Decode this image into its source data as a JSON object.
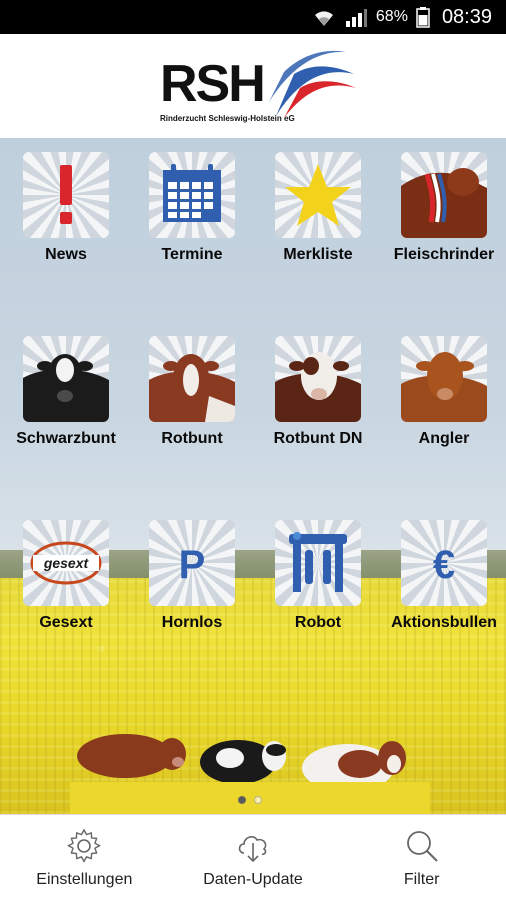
{
  "status_bar": {
    "battery_percent": "68%",
    "time": "08:39",
    "icons": [
      "wifi-icon",
      "cell-signal-icon",
      "battery-icon"
    ]
  },
  "header": {
    "logo_text": "RSH",
    "logo_subtitle": "Rinderzucht Schleswig-Holstein eG"
  },
  "tiles": [
    {
      "label": "News",
      "icon": "exclamation-icon"
    },
    {
      "label": "Termine",
      "icon": "calendar-icon"
    },
    {
      "label": "Merkliste",
      "icon": "star-icon"
    },
    {
      "label": "Fleischrinder",
      "icon": "beef-cattle-photo"
    },
    {
      "label": "Schwarzbunt",
      "icon": "black-white-cow-photo"
    },
    {
      "label": "Rotbunt",
      "icon": "red-white-cow-photo"
    },
    {
      "label": "Rotbunt DN",
      "icon": "red-white-dn-cow-photo"
    },
    {
      "label": "Angler",
      "icon": "angler-cow-photo"
    },
    {
      "label": "Gesext",
      "icon": "gesext-logo"
    },
    {
      "label": "Hornlos",
      "icon": "letter-p-icon"
    },
    {
      "label": "Robot",
      "icon": "milking-robot-icon"
    },
    {
      "label": "Aktionsbullen",
      "icon": "euro-icon"
    }
  ],
  "gesext_logo_text": "gesext",
  "hornlos_letter": "P",
  "euro_symbol": "€",
  "pager": {
    "pages": 2,
    "current": 1
  },
  "bottom_nav": [
    {
      "label": "Einstellungen",
      "icon": "gear-icon"
    },
    {
      "label": "Daten-Update",
      "icon": "cloud-download-icon"
    },
    {
      "label": "Filter",
      "icon": "search-icon"
    }
  ],
  "colors": {
    "accent_blue": "#2f5fae",
    "accent_red": "#d9262c",
    "star_yellow": "#f3d21c",
    "field_yellow": "#efe036"
  }
}
